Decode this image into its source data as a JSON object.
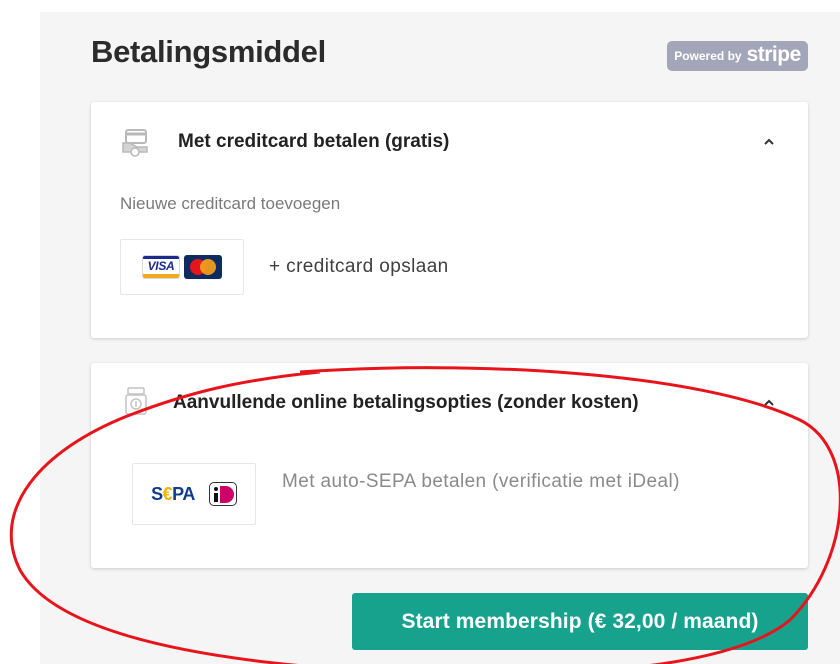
{
  "header": {
    "title": "Betalingsmiddel",
    "badge_prefix": "Powered by",
    "badge_brand": "stripe"
  },
  "creditcard_section": {
    "icon": "card-hand-icon",
    "title": "Met creditcard betalen (gratis)",
    "subtitle": "Nieuwe creditcard toevoegen",
    "visa_label": "VISA",
    "add_label": "+ creditcard opslaan"
  },
  "online_section": {
    "icon": "money-icon",
    "title": "Aanvullende online betalingsopties (zonder kosten)",
    "sepa_prefix": "S",
    "sepa_euro": "€",
    "sepa_suffix": "PA",
    "option_label": "Met auto-SEPA betalen (verificatie met iDeal)"
  },
  "actions": {
    "start_label": "Start membership (€ 32,00 / maand)"
  },
  "colors": {
    "primary": "#17a28e",
    "badge": "#a2a6b8",
    "annotation": "#e8141b"
  }
}
